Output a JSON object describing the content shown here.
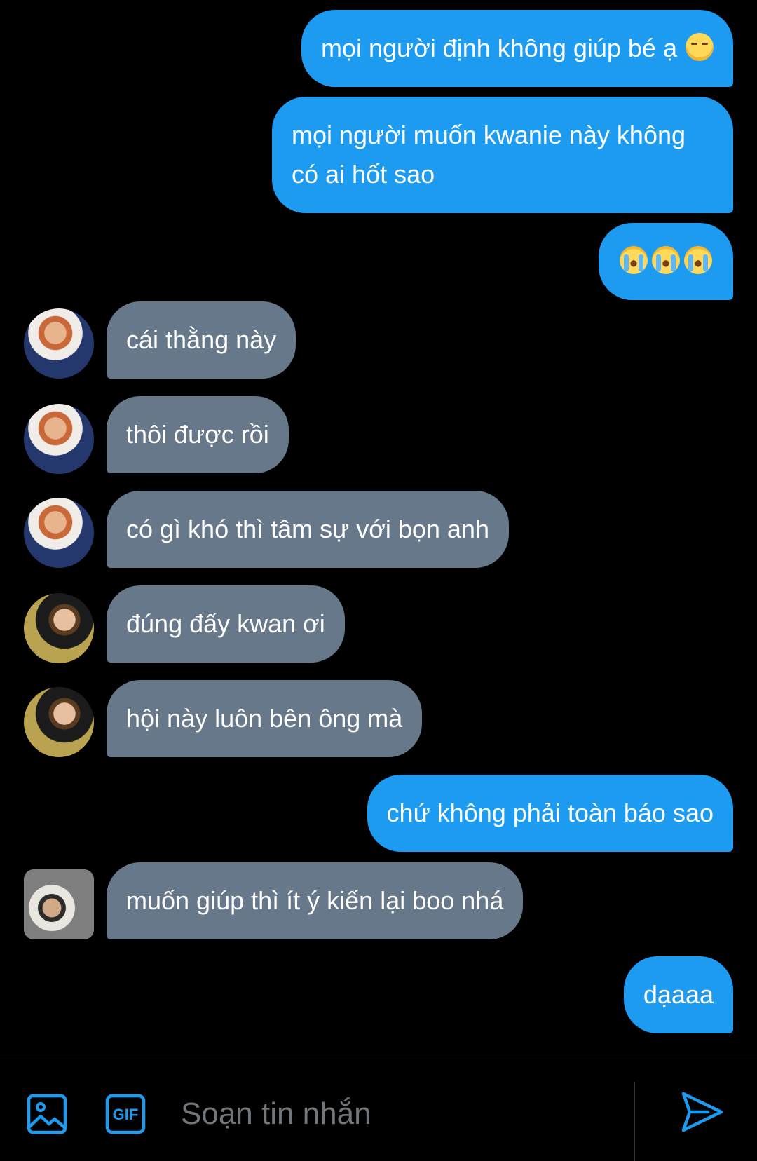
{
  "messages": [
    {
      "direction": "out",
      "text": "mọi người định không giúp bé ạ",
      "emoji": "pensive-face"
    },
    {
      "direction": "out",
      "text": "mọi người muốn kwanie này không có ai hốt sao"
    },
    {
      "direction": "out",
      "emoji_only": [
        "loudly-crying-face",
        "loudly-crying-face",
        "loudly-crying-face"
      ]
    },
    {
      "direction": "in",
      "avatar": "user-1",
      "text": "cái thằng này"
    },
    {
      "direction": "in",
      "avatar": "user-1",
      "text": "thôi được rồi"
    },
    {
      "direction": "in",
      "avatar": "user-1",
      "text": "có gì khó thì tâm sự với bọn anh"
    },
    {
      "direction": "in",
      "avatar": "user-2",
      "text": "đúng đấy kwan ơi"
    },
    {
      "direction": "in",
      "avatar": "user-2",
      "text": "hội này luôn bên ông mà"
    },
    {
      "direction": "out",
      "text": "chứ không phải toàn báo sao"
    },
    {
      "direction": "in",
      "avatar": "user-3",
      "text": "muốn giúp thì ít ý kiến lại boo nhá"
    },
    {
      "direction": "out",
      "text": "dạaaa"
    }
  ],
  "composer": {
    "placeholder": "Soạn tin nhắn",
    "media_icon": "image-icon",
    "gif_icon": "gif-icon",
    "gif_label": "GIF",
    "send_icon": "send-icon"
  },
  "colors": {
    "background": "#000000",
    "outgoing_bubble": "#1d9bf0",
    "incoming_bubble": "#67788a",
    "accent": "#1d9bf0",
    "placeholder": "#71767b"
  }
}
